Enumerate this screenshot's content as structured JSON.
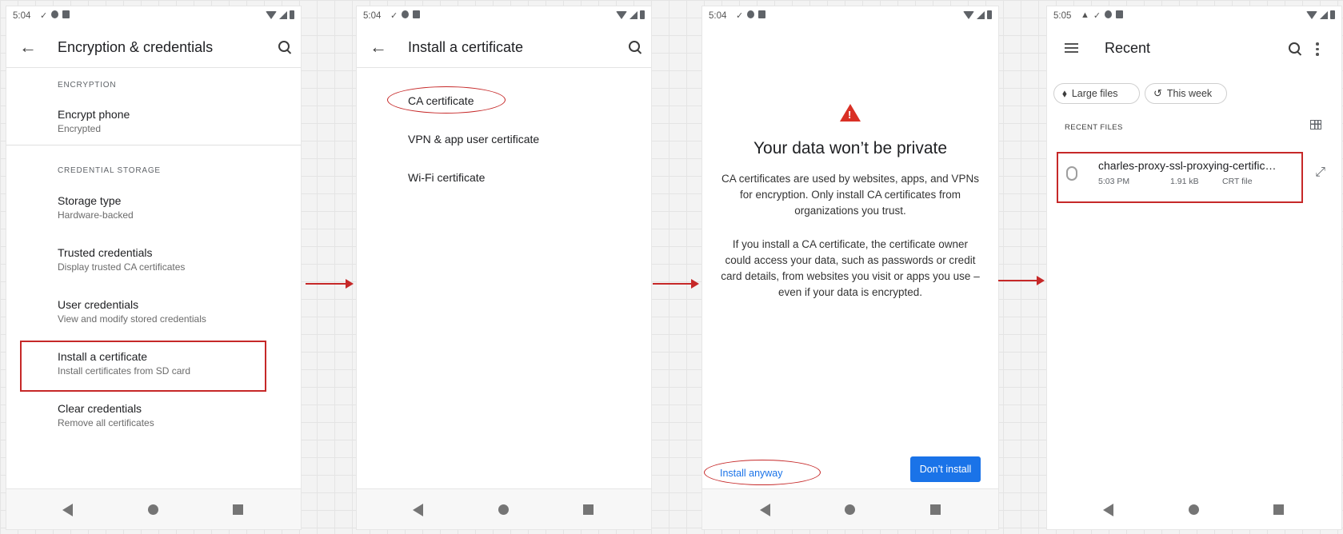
{
  "screen1": {
    "status_time": "5:04",
    "title": "Encryption & credentials",
    "section_encryption": "ENCRYPTION",
    "encrypt_title": "Encrypt phone",
    "encrypt_sub": "Encrypted",
    "section_storage": "CREDENTIAL STORAGE",
    "items": [
      {
        "title": "Storage type",
        "sub": "Hardware-backed"
      },
      {
        "title": "Trusted credentials",
        "sub": "Display trusted CA certificates"
      },
      {
        "title": "User credentials",
        "sub": "View and modify stored credentials"
      },
      {
        "title": "Install a certificate",
        "sub": "Install certificates from SD card"
      },
      {
        "title": "Clear credentials",
        "sub": "Remove all certificates"
      }
    ]
  },
  "screen2": {
    "status_time": "5:04",
    "title": "Install a certificate",
    "options": [
      "CA certificate",
      "VPN & app user certificate",
      "Wi-Fi certificate"
    ]
  },
  "screen3": {
    "status_time": "5:04",
    "dialog_title": "Your data won’t be private",
    "para1": "CA certificates are used by websites, apps, and VPNs for encryption. Only install CA certificates from organizations you trust.",
    "para2": "If you install a CA certificate, the certificate owner could access your data, such as passwords or credit card details, from websites you visit or apps you use – even if your data is encrypted.",
    "install_anyway": "Install anyway",
    "dont_install": "Don’t install"
  },
  "screen4": {
    "status_time": "5:05",
    "title": "Recent",
    "chip_large": "Large files",
    "chip_week": "This week",
    "recent_files_header": "RECENT FILES",
    "file": {
      "name": "charles-proxy-ssl-proxying-certific…",
      "time": "5:03 PM",
      "size": "1.91 kB",
      "type": "CRT file"
    }
  },
  "colors": {
    "highlight": "#c62828",
    "primary_button": "#1a73e8",
    "link": "#1a73e8"
  }
}
